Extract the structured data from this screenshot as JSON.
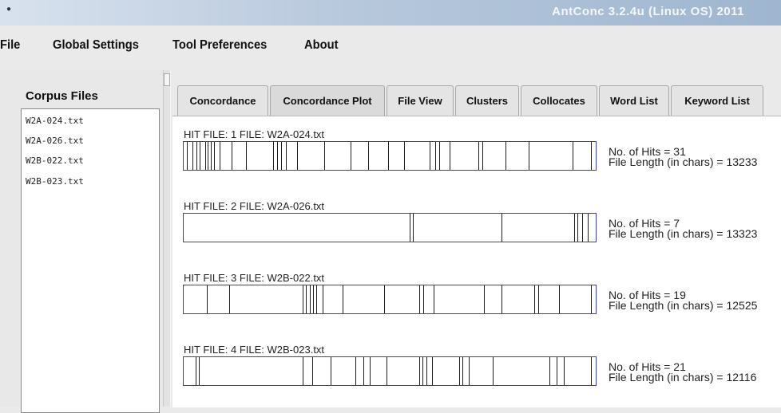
{
  "window": {
    "title": "AntConc 3.2.4u (Linux OS) 2011"
  },
  "menu": [
    "File",
    "Global Settings",
    "Tool Preferences",
    "About"
  ],
  "corpus": {
    "label": "Corpus Files",
    "files": [
      "W2A-024.txt",
      "W2A-026.txt",
      "W2B-022.txt",
      "W2B-023.txt"
    ]
  },
  "tabs": [
    {
      "label": "Concordance",
      "active": false
    },
    {
      "label": "Concordance Plot",
      "active": true
    },
    {
      "label": "File View",
      "active": false
    },
    {
      "label": "Clusters",
      "active": false
    },
    {
      "label": "Collocates",
      "active": false
    },
    {
      "label": "Word List",
      "active": false
    },
    {
      "label": "Keyword List",
      "active": false
    }
  ],
  "plots": [
    {
      "header": "HIT FILE: 1   FILE: W2A-024.txt",
      "hits_text": "No. of Hits = 31",
      "length_text": "File Length (in chars) = 13233",
      "hits": [
        0.008,
        0.022,
        0.031,
        0.038,
        0.052,
        0.058,
        0.066,
        0.074,
        0.088,
        0.116,
        0.152,
        0.218,
        0.228,
        0.236,
        0.248,
        0.276,
        0.342,
        0.406,
        0.448,
        0.498,
        0.536,
        0.598,
        0.612,
        0.622,
        0.646,
        0.716,
        0.726,
        0.782,
        0.838,
        0.946,
        0.99
      ]
    },
    {
      "header": "HIT FILE: 2   FILE: W2A-026.txt",
      "hits_text": "No. of Hits = 7",
      "length_text": "File Length (in chars) = 13323",
      "hits": [
        0.55,
        0.558,
        0.772,
        0.95,
        0.958,
        0.968,
        0.982
      ]
    },
    {
      "header": "HIT FILE: 3   FILE: W2B-022.txt",
      "hits_text": "No. of Hits = 19",
      "length_text": "File Length (in chars) = 12525",
      "hits": [
        0.056,
        0.11,
        0.29,
        0.298,
        0.306,
        0.314,
        0.322,
        0.338,
        0.386,
        0.488,
        0.572,
        0.582,
        0.608,
        0.73,
        0.772,
        0.852,
        0.862,
        0.912,
        0.99
      ]
    },
    {
      "header": "HIT FILE: 4   FILE: W2B-023.txt",
      "hits_text": "No. of Hits = 21",
      "length_text": "File Length (in chars) = 12116",
      "hits": [
        0.03,
        0.036,
        0.29,
        0.312,
        0.358,
        0.418,
        0.436,
        0.452,
        0.494,
        0.572,
        0.58,
        0.59,
        0.604,
        0.67,
        0.678,
        0.694,
        0.752,
        0.89,
        0.906,
        0.924,
        0.99
      ]
    }
  ]
}
